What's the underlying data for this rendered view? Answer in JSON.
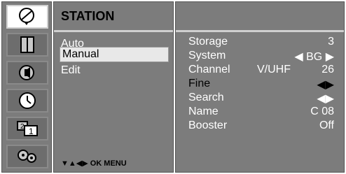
{
  "icons": [
    {
      "name": "station-icon",
      "active": true
    },
    {
      "name": "picture-icon",
      "active": false
    },
    {
      "name": "sound-icon",
      "active": false
    },
    {
      "name": "time-icon",
      "active": false
    },
    {
      "name": "special-icon",
      "active": false
    },
    {
      "name": "setup-icon",
      "active": false
    }
  ],
  "menu": {
    "title": "STATION",
    "items": [
      {
        "label": "Auto",
        "selected": false
      },
      {
        "label": "Manual",
        "selected": true
      },
      {
        "label": "Edit",
        "selected": false
      }
    ],
    "nav_hint": "▼▲◀▶ OK MENU"
  },
  "settings": {
    "rows": [
      {
        "label": "Storage",
        "mid": "",
        "value": "3",
        "black": false
      },
      {
        "label": "System",
        "mid": "",
        "value": "◀ BG ▶",
        "black": false
      },
      {
        "label": "Channel",
        "mid": "V/UHF",
        "value": "26",
        "black": false
      },
      {
        "label": "Fine",
        "mid": "",
        "value": "◀▶",
        "black": true
      },
      {
        "label": "Search",
        "mid": "",
        "value": "◀▶",
        "black": false
      },
      {
        "label": "Name",
        "mid": "",
        "value": "C 08",
        "black": false
      },
      {
        "label": "Booster",
        "mid": "",
        "value": "Off",
        "black": false
      }
    ]
  },
  "colors": {
    "panel": "#7c7c7c",
    "selected_bg": "#e8e8e8",
    "text_light": "#ffffff",
    "text_dark": "#000000"
  }
}
